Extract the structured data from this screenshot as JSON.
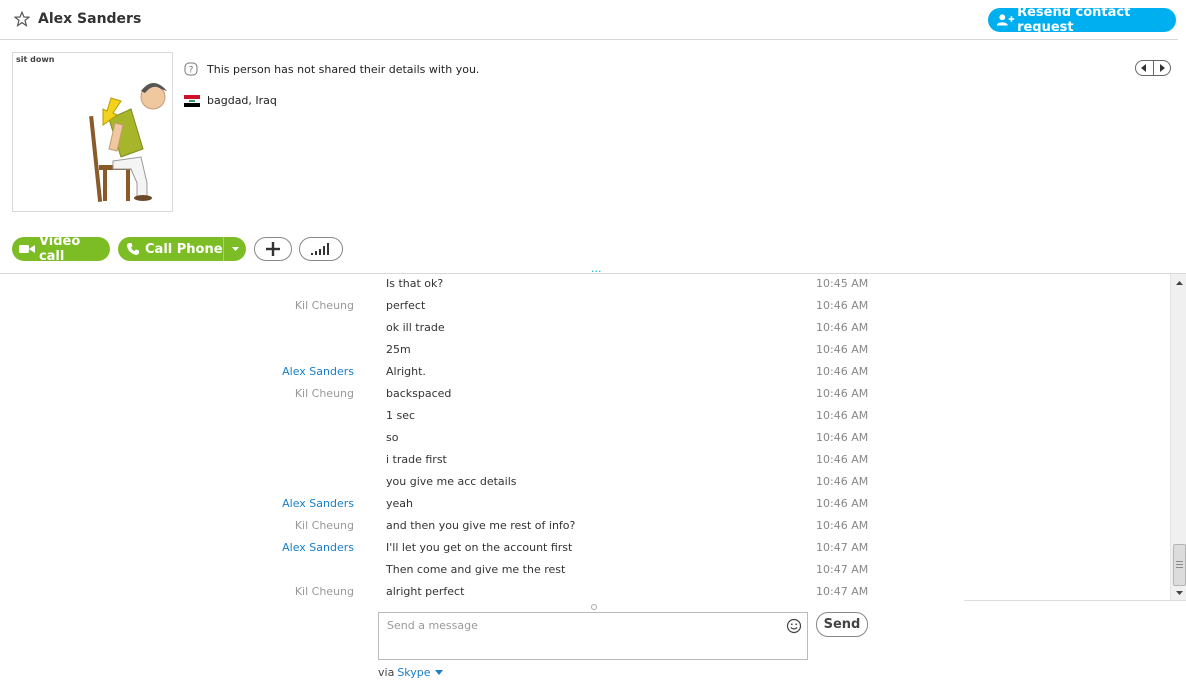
{
  "header": {
    "title": "Alex Sanders",
    "resend_label": "Resend contact request"
  },
  "profile": {
    "avatar_caption": "sit down",
    "details_note": "This person has not shared their details with you.",
    "location": "bagdad, Iraq"
  },
  "actions": {
    "video_call": "Video call",
    "call_phone": "Call Phone",
    "more_dots": "..."
  },
  "messages": [
    {
      "sender": "",
      "text": "Is that ok?",
      "time": "10:45 AM",
      "sender_color": "gray"
    },
    {
      "sender": "Kil Cheung",
      "text": "perfect",
      "time": "10:46 AM",
      "sender_color": "gray"
    },
    {
      "sender": "",
      "text": "ok ill trade",
      "time": "10:46 AM",
      "sender_color": "gray"
    },
    {
      "sender": "",
      "text": "25m",
      "time": "10:46 AM",
      "sender_color": "gray"
    },
    {
      "sender": "Alex Sanders",
      "text": "Alright.",
      "time": "10:46 AM",
      "sender_color": "blue"
    },
    {
      "sender": "Kil Cheung",
      "text": "backspaced",
      "time": "10:46 AM",
      "sender_color": "gray"
    },
    {
      "sender": "",
      "text": "1 sec",
      "time": "10:46 AM",
      "sender_color": "gray"
    },
    {
      "sender": "",
      "text": "so",
      "time": "10:46 AM",
      "sender_color": "gray"
    },
    {
      "sender": "",
      "text": "i trade first",
      "time": "10:46 AM",
      "sender_color": "gray"
    },
    {
      "sender": "",
      "text": "you give me acc details",
      "time": "10:46 AM",
      "sender_color": "gray"
    },
    {
      "sender": "Alex Sanders",
      "text": "yeah",
      "time": "10:46 AM",
      "sender_color": "blue"
    },
    {
      "sender": "Kil Cheung",
      "text": "and then you give me rest of info?",
      "time": "10:46 AM",
      "sender_color": "gray"
    },
    {
      "sender": "Alex Sanders",
      "text": "I'll let you get on the account first",
      "time": "10:47 AM",
      "sender_color": "blue"
    },
    {
      "sender": "",
      "text": "Then come and give me the rest",
      "time": "10:47 AM",
      "sender_color": "gray"
    },
    {
      "sender": "Kil Cheung",
      "text": "alright perfect",
      "time": "10:47 AM",
      "sender_color": "gray"
    }
  ],
  "composer": {
    "placeholder": "Send a message",
    "send_label": "Send",
    "via_label": "via",
    "via_service": "Skype"
  },
  "colors": {
    "skype_blue": "#00aff0",
    "call_green": "#7cbd26",
    "sender_blue": "#1a7ec8"
  }
}
